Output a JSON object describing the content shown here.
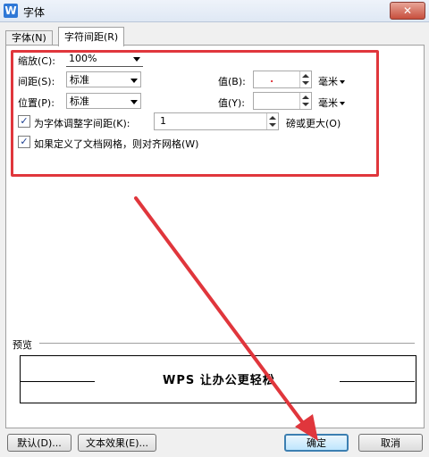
{
  "window": {
    "title": "字体",
    "app_icon": "W",
    "close": "✕"
  },
  "tabs": [
    {
      "label": "字体(N)",
      "active": false
    },
    {
      "label": "字符间距(R)",
      "active": true
    }
  ],
  "spacing": {
    "scale_label": "缩放(C):",
    "scale_value": "100%",
    "spacing_label": "间距(S):",
    "spacing_value": "标准",
    "spacing_val_label": "值(B):",
    "spacing_val_value": ".",
    "spacing_unit": "毫米",
    "position_label": "位置(P):",
    "position_value": "标准",
    "position_val_label": "值(Y):",
    "position_val_value": "",
    "position_unit": "毫米",
    "kerning_label": "为字体调整字间距(K):",
    "kerning_checked": true,
    "kerning_value": "1",
    "kerning_suffix": "磅或更大(O)",
    "grid_label": "如果定义了文档网格，则对齐网格(W)",
    "grid_checked": true
  },
  "preview": {
    "label": "预览",
    "sample_text": "WPS 让办公更轻松"
  },
  "buttons": {
    "default": "默认(D)...",
    "text_effect": "文本效果(E)...",
    "ok": "确定",
    "cancel": "取消"
  },
  "colors": {
    "highlight": "#e0363c",
    "accent": "#3c7fb1"
  }
}
